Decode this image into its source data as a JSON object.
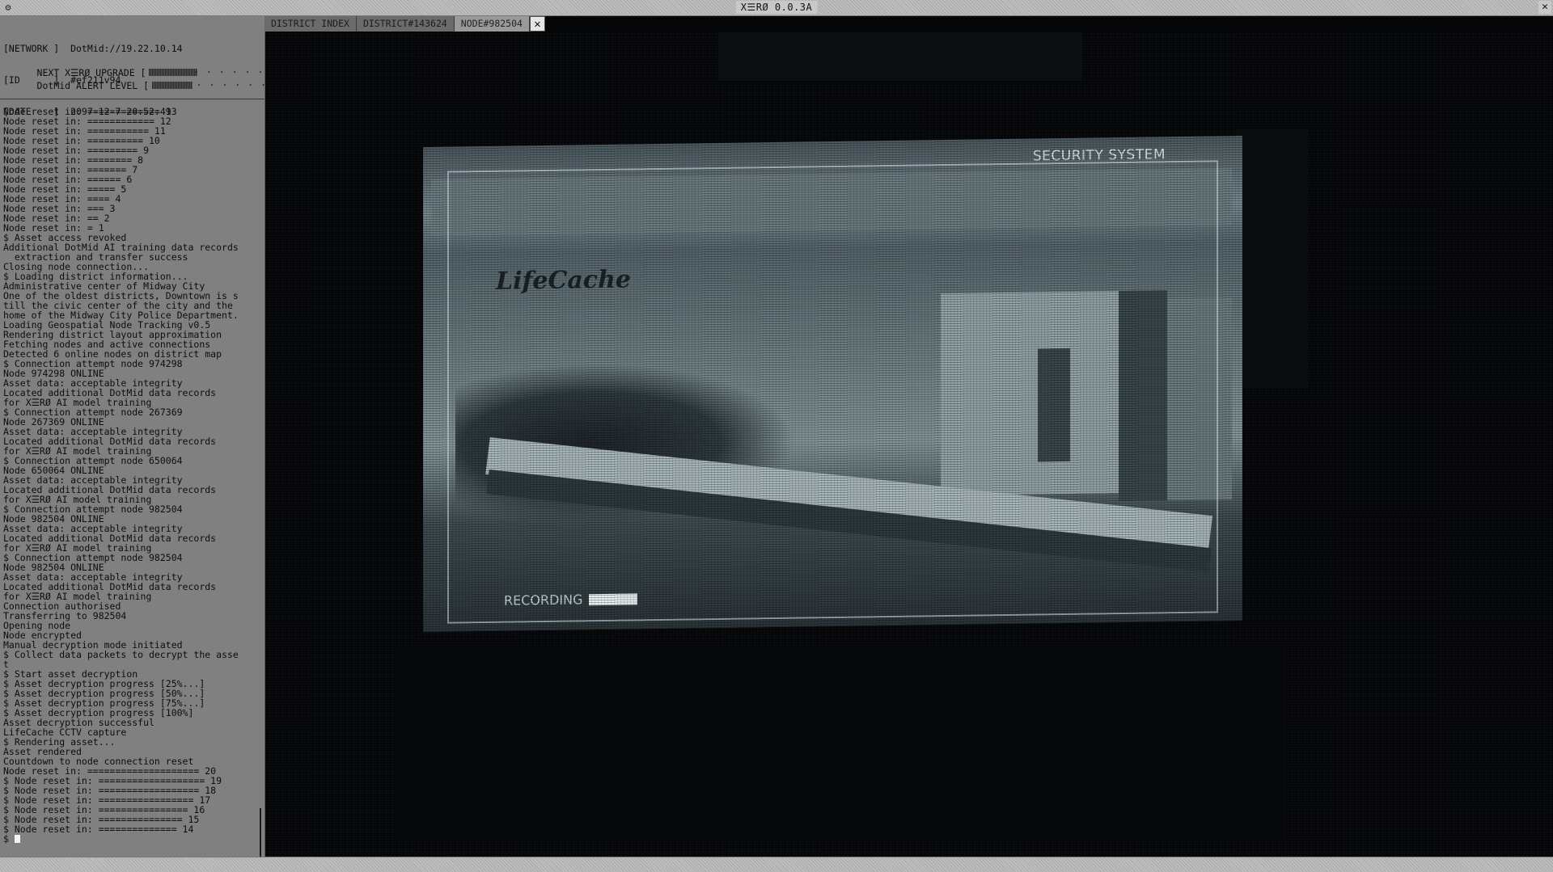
{
  "window": {
    "title": "X☰RØ 0.0.3A",
    "close_glyph": "✕"
  },
  "sidebar": {
    "info_lines": [
      "[NETWORK ]  DotMid://19.22.10.14",
      "[ID      ]  #ef211v94",
      "[DATE    ]  2097-12-7 20:52:49"
    ],
    "upgrade_label": "NEXT X☰RØ UPGRADE [",
    "upgrade_progress": 0.4,
    "alert_label": "DotMid ALERT LEVEL [",
    "alert_progress": 0.33,
    "meter_dots": "······",
    "meter_end": "]"
  },
  "log": {
    "lines": [
      "Node reset in: ============= 13",
      "Node reset in: ============ 12",
      "Node reset in: =========== 11",
      "Node reset in: ========== 10",
      "Node reset in: ========= 9",
      "Node reset in: ======== 8",
      "Node reset in: ======= 7",
      "Node reset in: ====== 6",
      "Node reset in: ===== 5",
      "Node reset in: ==== 4",
      "Node reset in: === 3",
      "Node reset in: == 2",
      "Node reset in: = 1",
      "$ Asset access revoked",
      "Additional DotMid AI training data records",
      "  extraction and transfer success",
      "Closing node connection...",
      "$ Loading district information...",
      "Administrative center of Midway City",
      "One of the oldest districts, Downtown is s",
      "till the civic center of the city and the",
      "home of the Midway City Police Department.",
      "Loading Geospatial Node Tracking v0.5",
      "Rendering district layout approximation",
      "Fetching nodes and active connections",
      "Detected 6 online nodes on district map",
      "$ Connection attempt node 974298",
      "Node 974298 ONLINE",
      "Asset data: acceptable integrity",
      "Located additional DotMid data records",
      "for X☰RØ AI model training",
      "$ Connection attempt node 267369",
      "Node 267369 ONLINE",
      "Asset data: acceptable integrity",
      "Located additional DotMid data records",
      "for X☰RØ AI model training",
      "$ Connection attempt node 650064",
      "Node 650064 ONLINE",
      "Asset data: acceptable integrity",
      "Located additional DotMid data records",
      "for X☰RØ AI model training",
      "$ Connection attempt node 982504",
      "Node 982504 ONLINE",
      "Asset data: acceptable integrity",
      "Located additional DotMid data records",
      "for X☰RØ AI model training",
      "$ Connection attempt node 982504",
      "Node 982504 ONLINE",
      "Asset data: acceptable integrity",
      "Located additional DotMid data records",
      "for X☰RØ AI model training",
      "Connection authorised",
      "Transferring to 982504",
      "Opening node",
      "Node encrypted",
      "Manual decryption mode initiated",
      "$ Collect data packets to decrypt the asse",
      "t",
      "$ Start asset decryption",
      "$ Asset decryption progress [25%...]",
      "$ Asset decryption progress [50%...]",
      "$ Asset decryption progress [75%...]",
      "$ Asset decryption progress [100%]",
      "Asset decryption successful",
      "LifeCache CCTV capture",
      "$ Rendering asset...",
      "Asset rendered",
      "Countdown to node connection reset",
      "Node reset in: ==================== 20",
      "$ Node reset in: =================== 19",
      "$ Node reset in: ================== 18",
      "$ Node reset in: ================= 17",
      "$ Node reset in: ================ 16",
      "$ Node reset in: =============== 15",
      "$ Node reset in: ============== 14"
    ],
    "prompt": "$ "
  },
  "tabs": [
    {
      "label": "DISTRICT INDEX",
      "active": false
    },
    {
      "label": "DISTRICT#143624",
      "active": false
    },
    {
      "label": "NODE#982504",
      "active": true
    }
  ],
  "tab_close_glyph": "✕",
  "feed": {
    "overlay_security": "SECURITY SYSTEM",
    "overlay_recording": "RECORDING",
    "brand": "LifeCache"
  }
}
